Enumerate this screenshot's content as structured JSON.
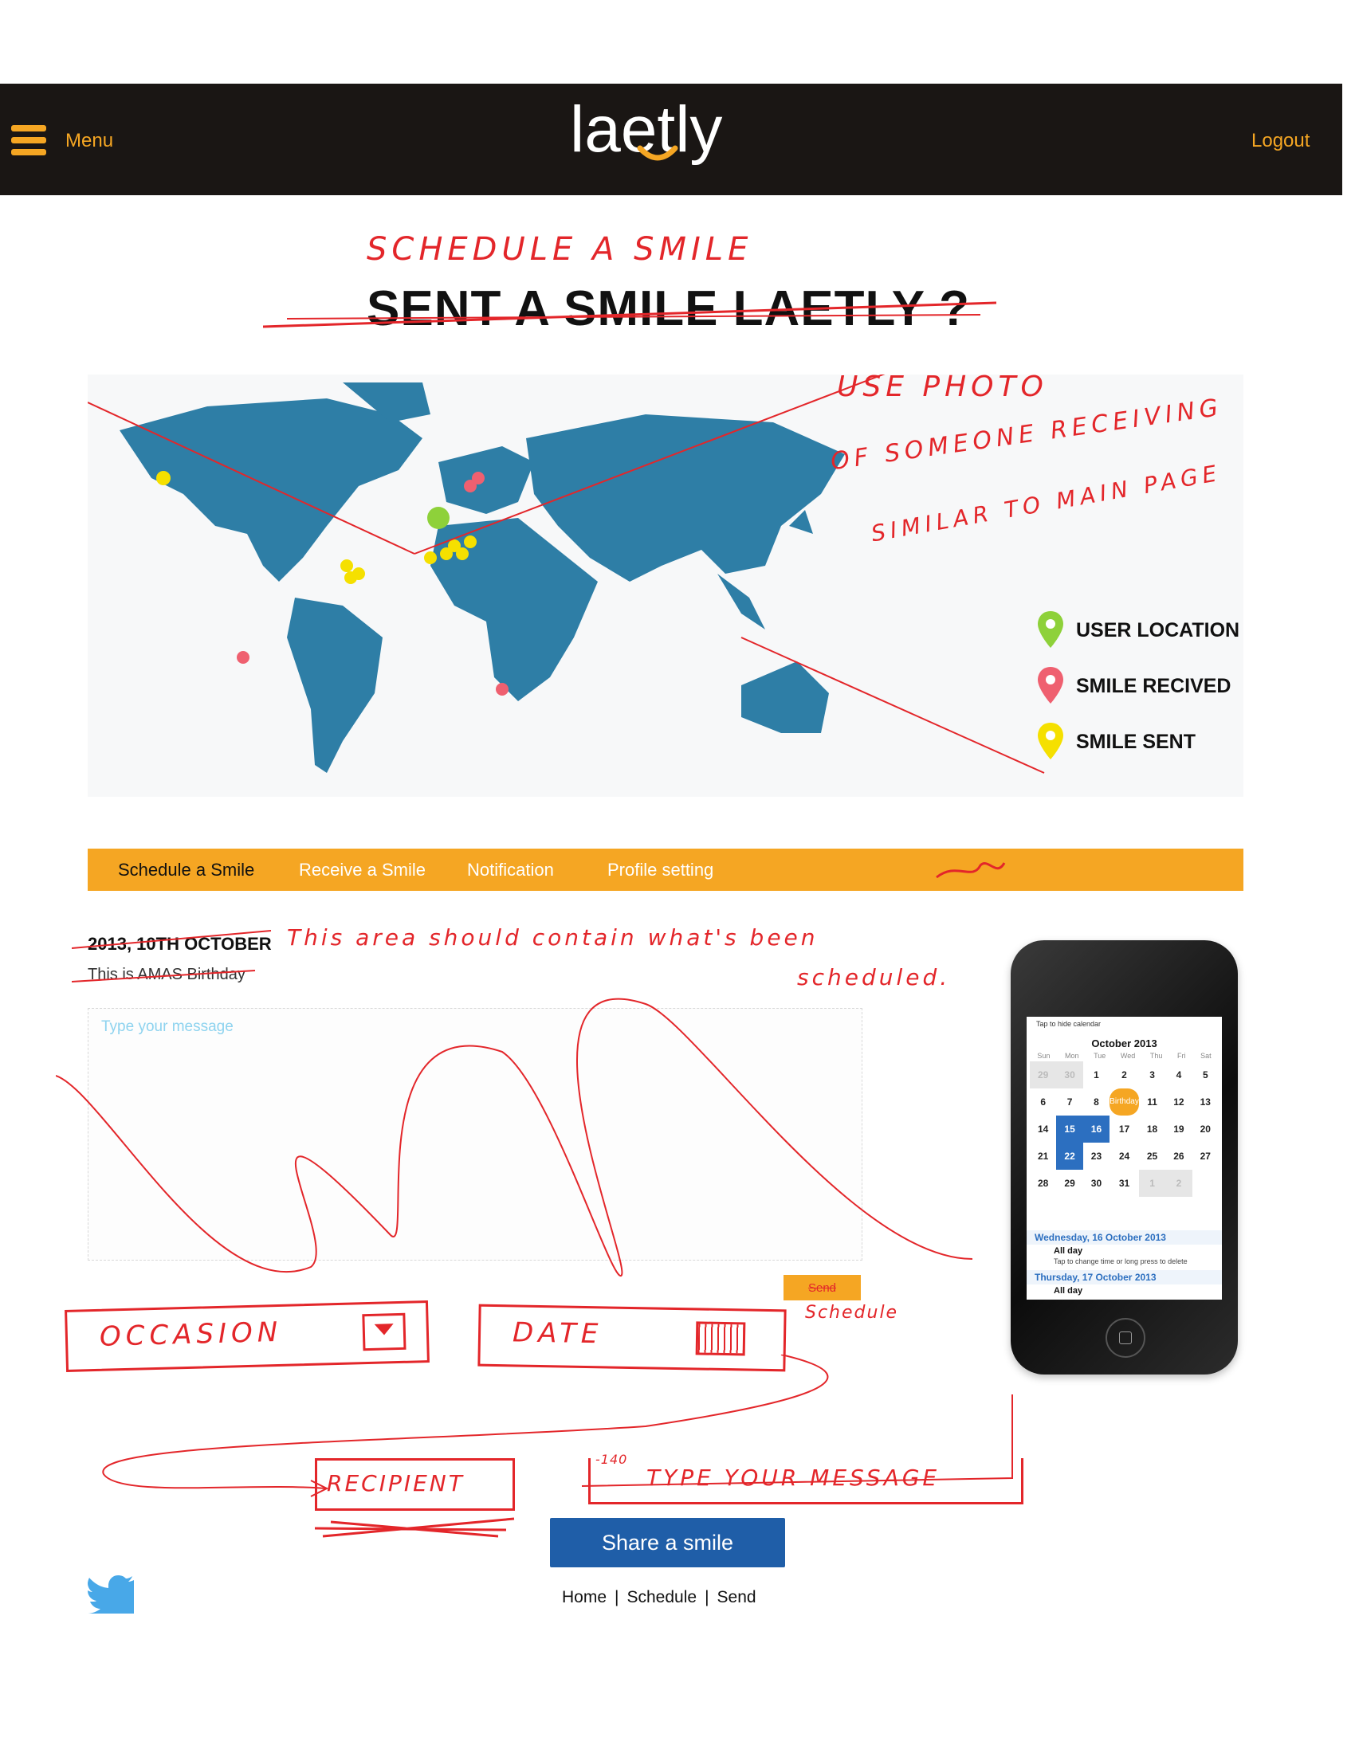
{
  "header": {
    "menu_label": "Menu",
    "logo_text": "laetly",
    "logout_label": "Logout",
    "accent": "#f5a623",
    "bg": "#1a1614"
  },
  "title": {
    "handwritten": "SCHEDULE A SMILE",
    "printed": "SENT A SMILE LAETLY ?"
  },
  "map_note": {
    "line1": "USE PHOTO",
    "line2": "OF SOMEONE RECEIVING",
    "line3": "SIMILAR TO MAIN PAGE"
  },
  "legend": [
    {
      "label": "USER LOCATION",
      "color": "#8ed13a"
    },
    {
      "label": "SMILE RECIVED",
      "color": "#ef6070"
    },
    {
      "label": "SMILE SENT",
      "color": "#f5e000"
    }
  ],
  "tabs": [
    "Schedule a Smile",
    "Receive a Smile",
    "Notification",
    "Profile setting"
  ],
  "schedule": {
    "date": "2013, 10TH OCTOBER",
    "occasion": "This is AMAS Birthday",
    "note_line1": "This area should contain what's been",
    "note_line2": "scheduled.",
    "placeholder": "Type your message",
    "send_label": "Send",
    "send_note": "Schedule"
  },
  "phone": {
    "hint": "Tap to hide calendar",
    "month": "October 2013",
    "days": [
      "Sun",
      "Mon",
      "Tue",
      "Wed",
      "Thu",
      "Fri",
      "Sat"
    ],
    "cells": [
      "29",
      "30",
      "1",
      "2",
      "3",
      "4",
      "5",
      "6",
      "7",
      "8",
      "Birthday",
      "11",
      "12",
      "13",
      "14",
      "15",
      "16",
      "17",
      "18",
      "19",
      "20",
      "21",
      "22",
      "23",
      "24",
      "25",
      "26",
      "27",
      "28",
      "29",
      "30",
      "31",
      "1",
      "2"
    ],
    "event1_date": "Wednesday, 16 October 2013",
    "event1_title": "All day",
    "event1_sub": "Tap to change time or long press to delete",
    "event2_date": "Thursday, 17 October 2013",
    "event2_title": "All day"
  },
  "sketch": {
    "occasion": "OCCASION",
    "date": "DATE",
    "recipient": "RECIPIENT",
    "message_counter": "-140",
    "message": "TYPE YOUR MESSAGE"
  },
  "share_label": "Share a smile",
  "footer": {
    "home": "Home",
    "schedule": "Schedule",
    "send": "Send",
    "separator": "|"
  }
}
